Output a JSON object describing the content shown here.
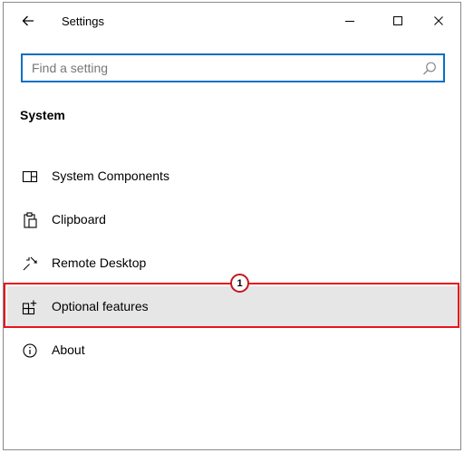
{
  "window": {
    "title": "Settings"
  },
  "search": {
    "placeholder": "Find a setting",
    "value": ""
  },
  "section": {
    "heading": "System"
  },
  "nav": {
    "items": [
      {
        "label": "System Components",
        "icon": "system-components-icon"
      },
      {
        "label": "Clipboard",
        "icon": "clipboard-icon"
      },
      {
        "label": "Remote Desktop",
        "icon": "remote-desktop-icon"
      },
      {
        "label": "Optional features",
        "icon": "optional-features-icon",
        "selected": true
      },
      {
        "label": "About",
        "icon": "info-icon"
      }
    ]
  },
  "annotation": {
    "step_number": "1",
    "highlight_color": "#e8141b"
  },
  "colors": {
    "accent": "#0a6fc2",
    "selected_bg": "#e6e6e6"
  }
}
